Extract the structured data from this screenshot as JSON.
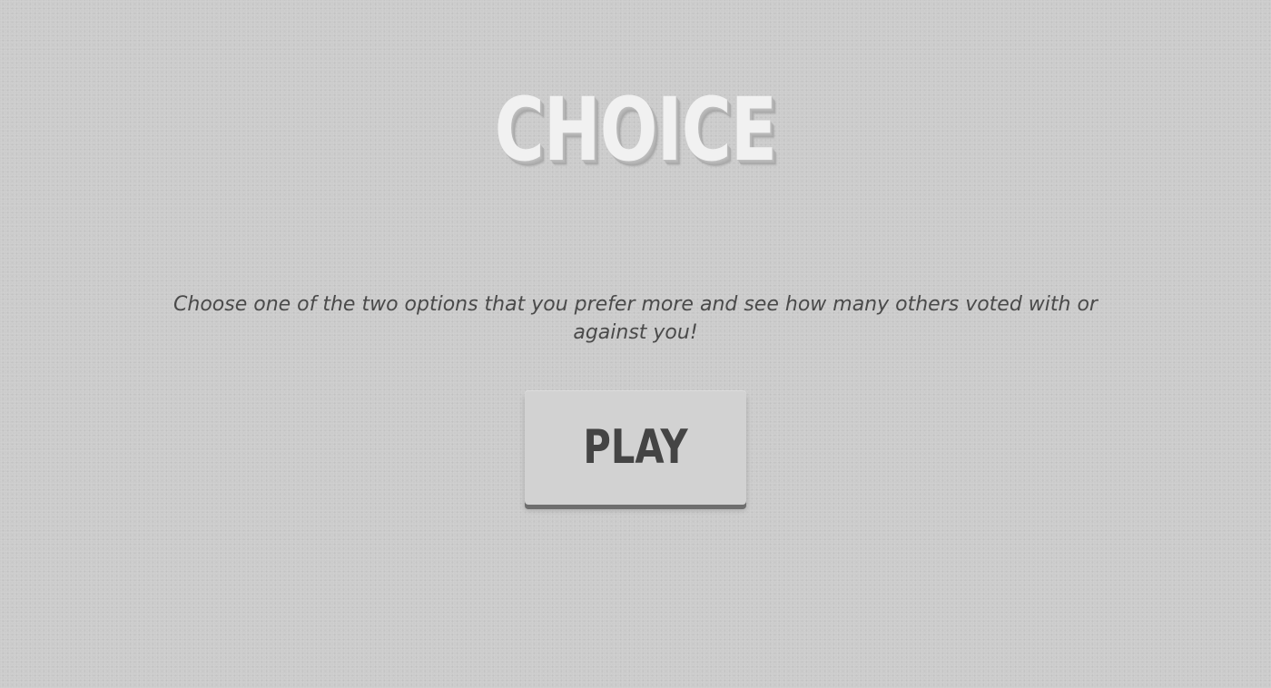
{
  "app": {
    "title": "CHOICE"
  },
  "intro": {
    "description": "Choose one of the two options that you prefer more and see how many others voted with or against you!"
  },
  "actions": {
    "play_label": "PLAY"
  }
}
